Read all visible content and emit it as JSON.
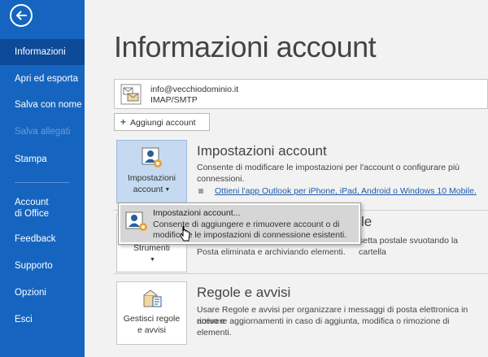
{
  "sidebar": {
    "items": [
      {
        "label": "Informazioni",
        "active": true
      },
      {
        "label": "Apri ed esporta"
      },
      {
        "label": "Salva con nome"
      },
      {
        "label": "Salva allegati",
        "disabled": true
      },
      {
        "label": "Stampa"
      },
      {
        "label_line1": "Account",
        "label_line2": "di Office"
      },
      {
        "label": "Feedback"
      },
      {
        "label": "Supporto"
      },
      {
        "label": "Opzioni"
      },
      {
        "label": "Esci"
      }
    ]
  },
  "main": {
    "title": "Informazioni account",
    "account": {
      "email": "info@vecchiodominio.it",
      "type": "IMAP/SMTP"
    },
    "add_account_label": "Aggiungi account",
    "sections": {
      "account_settings": {
        "button_line1": "Impostazioni",
        "button_line2": "account",
        "title": "Impostazioni account",
        "desc_line1": "Consente di modificare le impostazioni per l'account o configurare più",
        "desc_line2": "connessioni.",
        "link": "Ottieni l'app Outlook per iPhone, iPad, Android o Windows 10 Mobile."
      },
      "tools": {
        "button_label": "Strumenti",
        "title_fragment": "le",
        "desc_line1": "setta postale svuotando la cartella",
        "desc_line2": "Posta eliminata e archiviando elementi."
      },
      "rules": {
        "button_line1": "Gestisci regole",
        "button_line2": "e avvisi",
        "title": "Regole e avvisi",
        "desc_line1": "Usare Regole e avvisi per organizzare i messaggi di posta elettronica in arrivo e",
        "desc_line2": "ricevere aggiornamenti in caso di aggiunta, modifica o rimozione di elementi."
      }
    },
    "popup": {
      "title": "Impostazioni account...",
      "desc_line1": "Consente di aggiungere e rimuovere account o di",
      "desc_line2": "modificare le impostazioni di connessione esistenti."
    }
  },
  "colors": {
    "sidebar": "#1565c0",
    "sidebar_active": "#0d4a99",
    "link": "#1f5aa8",
    "accent_orange": "#e8a33a"
  }
}
